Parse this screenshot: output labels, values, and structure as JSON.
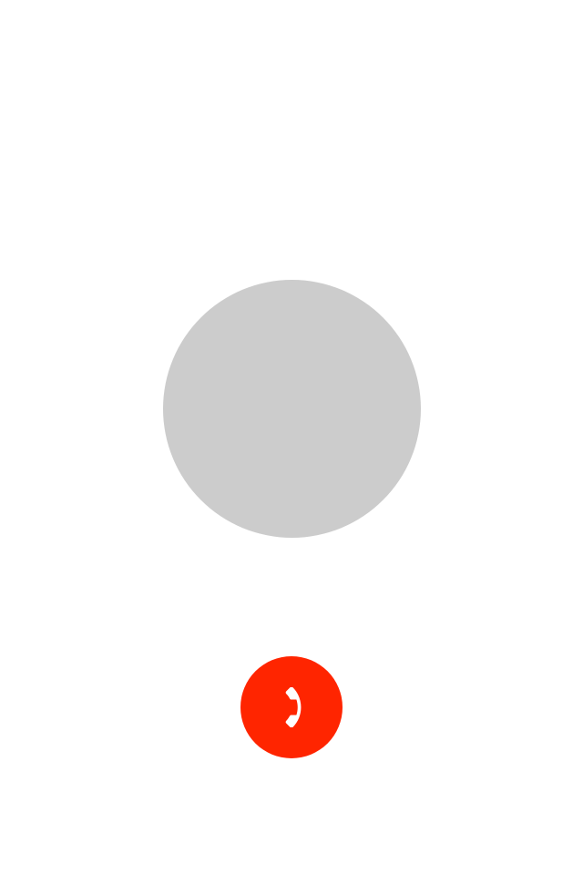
{
  "call": {
    "end_call_icon": "phone-handset-icon",
    "colors": {
      "background": "#ffffff",
      "avatar_placeholder": "#cccccc",
      "end_call": "#ff2500",
      "icon": "#ffffff"
    }
  }
}
